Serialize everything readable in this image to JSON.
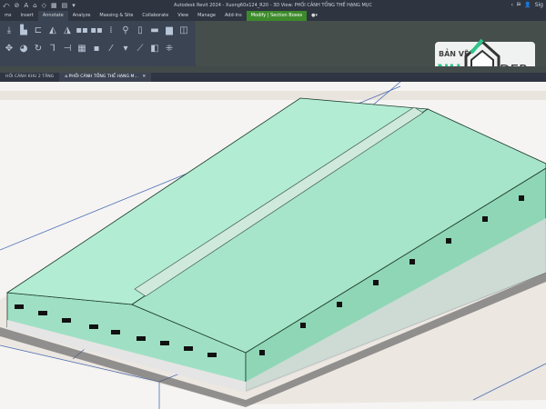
{
  "app": {
    "title": "Autodesk Revit 2024 - Xuong60x124_R20 - 3D View: PHỐI CẢNH TỔNG THỂ HẠNG MỤC"
  },
  "qat": [
    "⤺",
    "⊘",
    "A",
    "⌂",
    "◇",
    "▦",
    "▤",
    "▾"
  ],
  "window_controls": [
    "‹",
    "⛿",
    "👤",
    "Sig"
  ],
  "ribbon_tabs": [
    {
      "label": "ms",
      "state": "normal"
    },
    {
      "label": "Insert",
      "state": "normal"
    },
    {
      "label": "Annotate",
      "state": "active"
    },
    {
      "label": "Analyze",
      "state": "normal"
    },
    {
      "label": "Massing & Site",
      "state": "normal"
    },
    {
      "label": "Collaborate",
      "state": "normal"
    },
    {
      "label": "View",
      "state": "normal"
    },
    {
      "label": "Manage",
      "state": "normal"
    },
    {
      "label": "Add-Ins",
      "state": "normal"
    },
    {
      "label": "Modify | Section Boxes",
      "state": "modify"
    },
    {
      "label": "●▾",
      "state": "normal"
    }
  ],
  "ribbon_tools": [
    "⤓",
    "▙",
    "⊏",
    "◭",
    "◮",
    "▪▪",
    "▪▪",
    "⁞",
    "⚲",
    "▯",
    "▬",
    "▆",
    "◫",
    "",
    "✥",
    "◕",
    "↻",
    "⅂",
    "⊣",
    "▦",
    "▪",
    "⁄",
    "▾",
    "⟋",
    "◧",
    "⁜"
  ],
  "ribbon_label": "ate",
  "view_tabs": [
    {
      "label": "HỐI CẢNH KHU 2 TẦNG",
      "active": false
    },
    {
      "label": "PHỐI CẢNH TỔNG THỂ HẠNG M...",
      "active": true,
      "icon": "house-icon",
      "close": "✕"
    }
  ],
  "logo": {
    "line1": "BẢN VẼ",
    "line2a": "NH",
    "line2b": "ĐẸP",
    "color": "#2ec58a"
  },
  "colors": {
    "roof": "#aee9cf",
    "wall": "#9fe0c4",
    "accent": "#3d8a2a"
  }
}
